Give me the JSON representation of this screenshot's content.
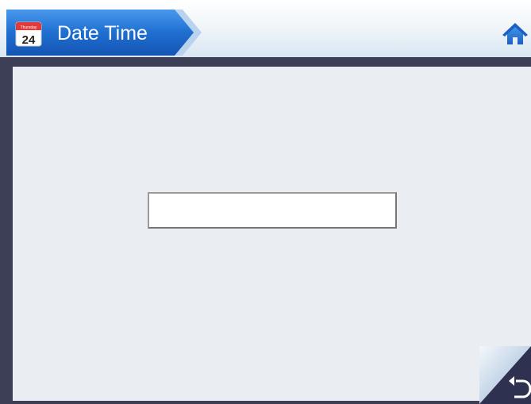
{
  "header": {
    "title": "Date Time",
    "calendar_icon": {
      "name": "calendar-icon",
      "weekday": "Thursday",
      "day": "24"
    },
    "home_icon": "home-icon"
  },
  "main": {
    "datetime_field": {
      "value": "",
      "placeholder": ""
    }
  },
  "footer": {
    "back_icon": "back-arrow-icon"
  },
  "colors": {
    "header_tab": "#1f6fd1",
    "frame": "#3d3f56",
    "panel": "#eaedf1",
    "field": "#ffffff"
  }
}
